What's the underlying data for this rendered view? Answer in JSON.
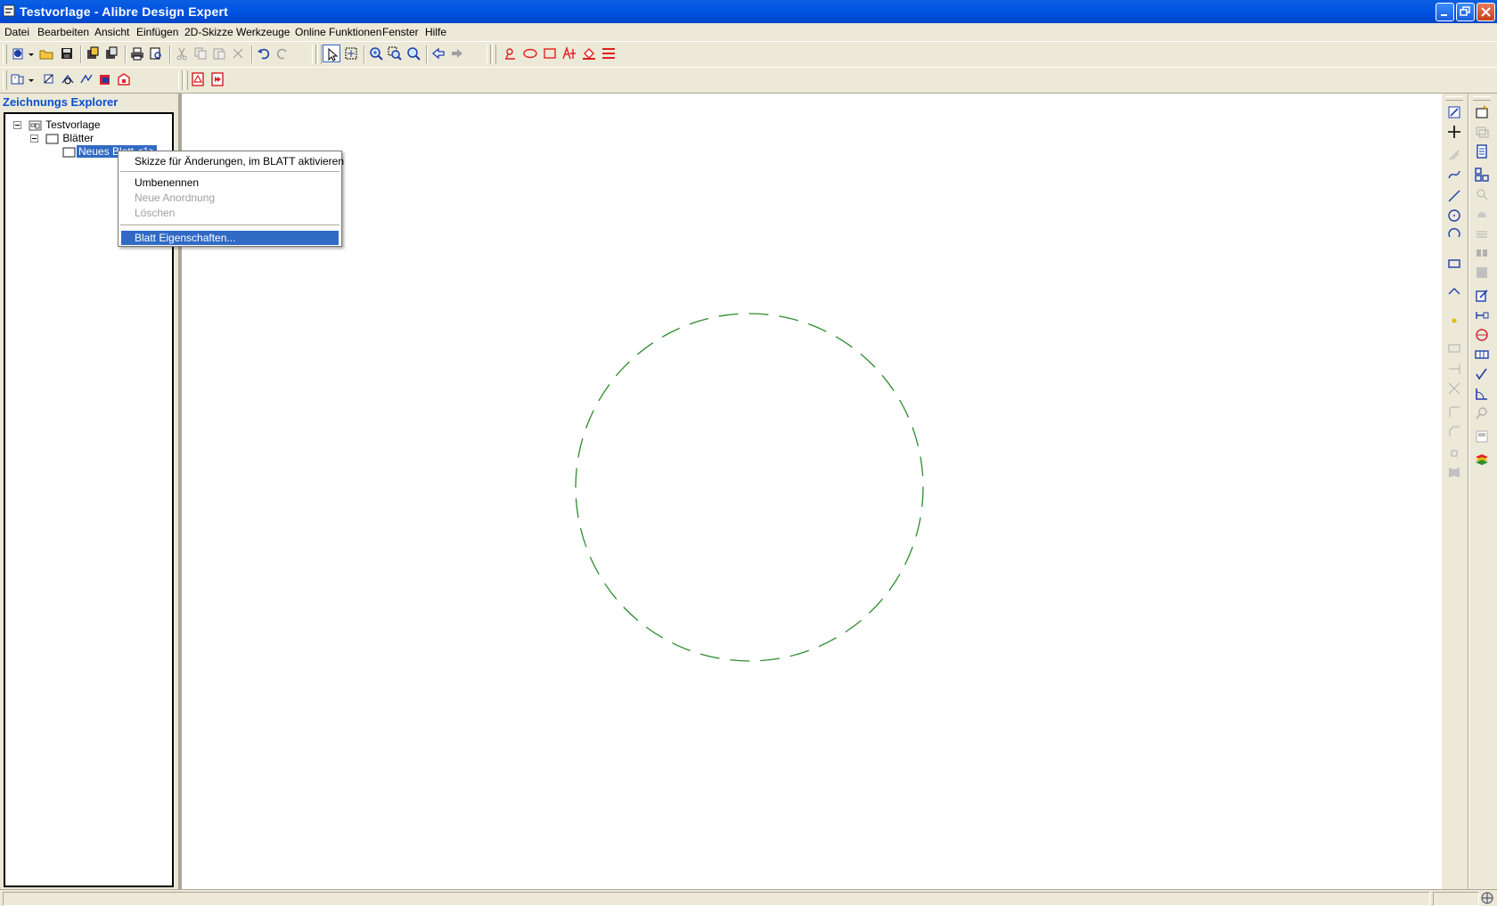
{
  "window": {
    "title": "Testvorlage - Alibre Design Expert"
  },
  "menu": [
    "Datei",
    "Bearbeiten",
    "Ansicht",
    "Einfügen",
    "2D-Skizze",
    "Werkzeuge",
    "Online Funktionen",
    "Fenster",
    "Hilfe"
  ],
  "explorer": {
    "header": "Zeichnungs Explorer",
    "tree": {
      "root": "Testvorlage",
      "folder": "Blätter",
      "sheet": "Neues Blatt <1>"
    }
  },
  "context_menu": {
    "items": [
      {
        "label": "Skizze für Änderungen, im BLATT aktivieren",
        "enabled": true
      },
      {
        "label": "Umbenennen",
        "enabled": true
      },
      {
        "label": "Neue Anordnung",
        "enabled": false
      },
      {
        "label": "Löschen",
        "enabled": false
      },
      {
        "label": "Blatt Eigenschaften...",
        "enabled": true,
        "highlighted": true
      }
    ]
  },
  "drawing": {
    "shape": "dashed-circle",
    "color": "#2e8b2e"
  },
  "colors": {
    "titlebar": "#0054e3",
    "selection": "#316ac5",
    "explorer_header": "#0a4fd0",
    "tool_red": "#e02020",
    "tool_blue": "#1f3ea8"
  }
}
